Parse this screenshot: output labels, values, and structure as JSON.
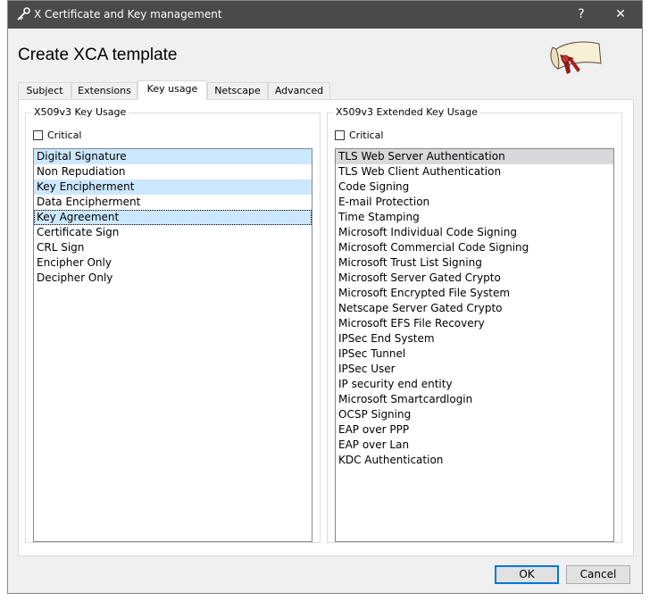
{
  "window": {
    "title": "X Certificate and Key management",
    "help_label": "?",
    "close_label": "✕"
  },
  "header": {
    "title": "Create XCA template"
  },
  "tabs": [
    {
      "label": "Subject"
    },
    {
      "label": "Extensions"
    },
    {
      "label": "Key usage"
    },
    {
      "label": "Netscape"
    },
    {
      "label": "Advanced"
    }
  ],
  "key_usage": {
    "group_title": "X509v3 Key Usage",
    "critical_label": "Critical",
    "items": [
      {
        "label": "Digital Signature",
        "state": "selected"
      },
      {
        "label": "Non Repudiation",
        "state": ""
      },
      {
        "label": "Key Encipherment",
        "state": "selected"
      },
      {
        "label": "Data Encipherment",
        "state": ""
      },
      {
        "label": "Key Agreement",
        "state": "focused"
      },
      {
        "label": "Certificate Sign",
        "state": ""
      },
      {
        "label": "CRL Sign",
        "state": ""
      },
      {
        "label": "Encipher Only",
        "state": ""
      },
      {
        "label": "Decipher Only",
        "state": ""
      }
    ]
  },
  "extended_key_usage": {
    "group_title": "X509v3 Extended Key Usage",
    "critical_label": "Critical",
    "items": [
      {
        "label": "TLS Web Server Authentication",
        "state": "grey"
      },
      {
        "label": "TLS Web Client Authentication",
        "state": ""
      },
      {
        "label": "Code Signing",
        "state": ""
      },
      {
        "label": "E-mail Protection",
        "state": ""
      },
      {
        "label": "Time Stamping",
        "state": ""
      },
      {
        "label": "Microsoft Individual Code Signing",
        "state": ""
      },
      {
        "label": "Microsoft Commercial Code Signing",
        "state": ""
      },
      {
        "label": "Microsoft Trust List Signing",
        "state": ""
      },
      {
        "label": "Microsoft Server Gated Crypto",
        "state": ""
      },
      {
        "label": "Microsoft Encrypted File System",
        "state": ""
      },
      {
        "label": "Netscape Server Gated Crypto",
        "state": ""
      },
      {
        "label": "Microsoft EFS File Recovery",
        "state": ""
      },
      {
        "label": "IPSec End System",
        "state": ""
      },
      {
        "label": "IPSec Tunnel",
        "state": ""
      },
      {
        "label": "IPSec User",
        "state": ""
      },
      {
        "label": "IP security end entity",
        "state": ""
      },
      {
        "label": "Microsoft Smartcardlogin",
        "state": ""
      },
      {
        "label": "OCSP Signing",
        "state": ""
      },
      {
        "label": "EAP over PPP",
        "state": ""
      },
      {
        "label": "EAP over Lan",
        "state": ""
      },
      {
        "label": "KDC Authentication",
        "state": ""
      }
    ]
  },
  "buttons": {
    "ok": "OK",
    "cancel": "Cancel"
  },
  "colors": {
    "titlebar": "#4a4a4a",
    "selection": "#cce8ff",
    "accent": "#0078d7"
  }
}
